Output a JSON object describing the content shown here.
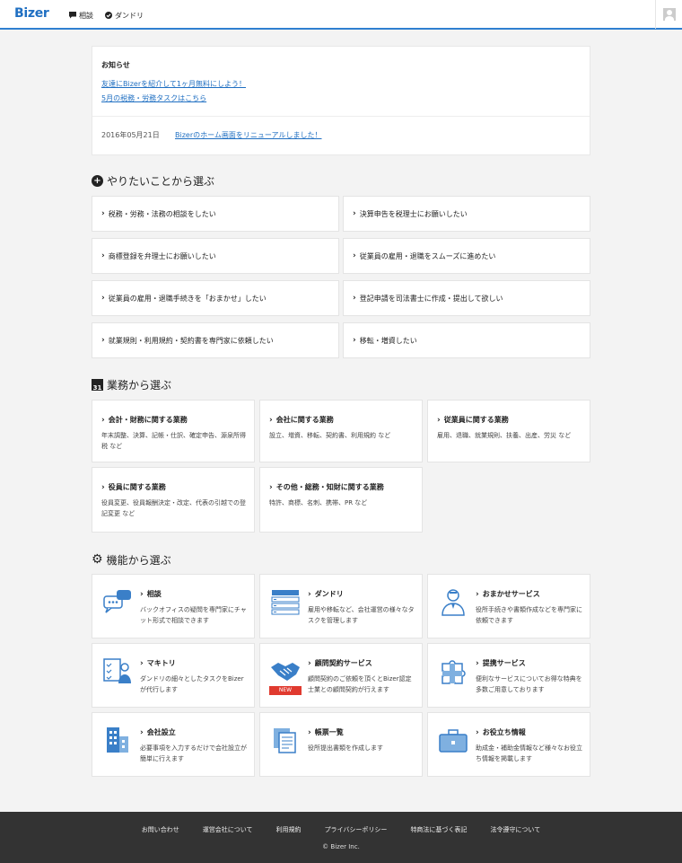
{
  "header": {
    "logo": "Bizer",
    "nav": [
      {
        "label": "相談",
        "icon": "speech-bubble-icon"
      },
      {
        "label": "ダンドリ",
        "icon": "check-circle-icon"
      }
    ]
  },
  "notice": {
    "title": "お知らせ",
    "links": [
      "友達にBizerを紹介して1ヶ月無料にしよう！",
      "5月の税務・労務タスクはこちら"
    ],
    "date": "2016年05月21日",
    "date_link": "Bizerのホーム画面をリニューアルしました！"
  },
  "want": {
    "title": "やりたいことから選ぶ",
    "items": [
      "税務・労務・法務の相談をしたい",
      "決算申告を税理士にお願いしたい",
      "商標登録を弁理士にお願いしたい",
      "従業員の雇用・退職をスムーズに進めたい",
      "従業員の雇用・退職手続きを「おまかせ」したい",
      "登記申請を司法書士に作成・提出して欲しい",
      "就業規則・利用規約・契約書を専門家に依頼したい",
      "移転・増資したい"
    ]
  },
  "business": {
    "title": "業務から選ぶ",
    "calendar_day": "31",
    "items": [
      {
        "title": "会計・財務に関する業務",
        "desc": "年末調整、決算、記帳・仕訳、確定申告、源泉所得税 など"
      },
      {
        "title": "会社に関する業務",
        "desc": "設立、増資、移転、契約書、利用規約 など"
      },
      {
        "title": "従業員に関する業務",
        "desc": "雇用、退職、就業規則、扶養、出産、労災 など"
      },
      {
        "title": "役員に関する業務",
        "desc": "役員変更、役員報酬決定・改定、代表の引越での登記変更 など"
      },
      {
        "title": "その他・総務・知財に関する業務",
        "desc": "特許、商標、名刺、携帯、PR など"
      }
    ]
  },
  "features": {
    "title": "機能から選ぶ",
    "items": [
      {
        "title": "相談",
        "desc": "バックオフィスの疑問を専門家にチャット形式で相談できます",
        "icon": "chat-bubbles-icon"
      },
      {
        "title": "ダンドリ",
        "desc": "雇用や移転など、会社運営の様々なタスクを管理します",
        "icon": "task-list-icon"
      },
      {
        "title": "おまかせサービス",
        "desc": "役所手続きや書類作成などを専門家に依頼できます",
        "icon": "specialist-icon"
      },
      {
        "title": "マキトリ",
        "desc": "ダンドリの細々としたタスクをBizerが代行します",
        "icon": "checklist-person-icon"
      },
      {
        "title": "顧問契約サービス",
        "desc": "顧問契約のご依頼を頂くとBizer認定士業との顧問契約が行えます",
        "icon": "handshake-icon",
        "badge": "NEW"
      },
      {
        "title": "提携サービス",
        "desc": "便利なサービスについてお得な特典を多数ご用意しております",
        "icon": "puzzle-icon"
      },
      {
        "title": "会社設立",
        "desc": "必要事項を入力するだけで会社設立が簡単に行えます",
        "icon": "building-icon"
      },
      {
        "title": "帳票一覧",
        "desc": "役所提出書類を作成します",
        "icon": "documents-icon"
      },
      {
        "title": "お役立ち情報",
        "desc": "助成金・補助金情報など様々なお役立ち情報を掲載します",
        "icon": "briefcase-icon"
      }
    ]
  },
  "footer": {
    "links": [
      "お問い合わせ",
      "運営会社について",
      "利用規約",
      "プライバシーポリシー",
      "特商法に基づく表記",
      "法令遵守について"
    ],
    "copyright": "© Bizer Inc."
  },
  "colors": {
    "brand": "#1f6fc2",
    "badge": "#e03a2f",
    "footer": "#333333"
  }
}
